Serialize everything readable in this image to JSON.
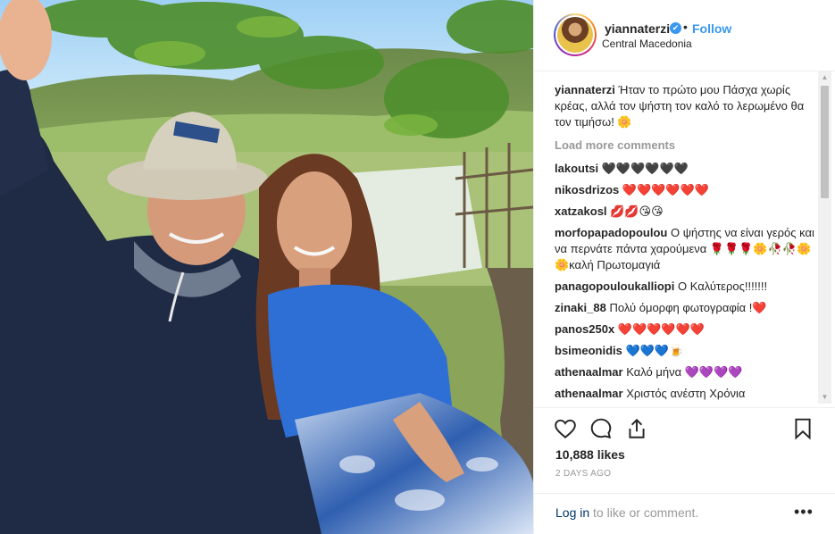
{
  "header": {
    "username": "yiannaterzi",
    "verified_mark": "✔",
    "separator": "•",
    "follow_label": "Follow",
    "location": "Central Macedonia"
  },
  "caption": {
    "username": "yiannaterzi",
    "text": "Ήταν το πρώτο μου Πάσχα χωρίς κρέας, αλλά τον ψήστη τον καλό το λερωμένο θα τον τιμήσω! 🌼"
  },
  "load_more_label": "Load more comments",
  "comments": [
    {
      "username": "lakoutsi",
      "text": "🖤🖤🖤🖤🖤🖤"
    },
    {
      "username": "nikosdrizos",
      "text": "❤️❤️❤️❤️❤️❤️"
    },
    {
      "username": "xatzakosl",
      "text": "💋💋😘😘"
    },
    {
      "username": "morfopapadopoulou",
      "text": "Ο ψήστης να είναι γερός και να περνάτε πάντα χαρούμενα 🌹🌹🌹🌼🥀🥀🌼🌼καλή Πρωτομαγιά"
    },
    {
      "username": "panagopouloukalliopi",
      "text": "Ο Καλύτερος!!!!!!!"
    },
    {
      "username": "zinaki_88",
      "text": "Πολύ όμορφη φωτογραφία !❤️"
    },
    {
      "username": "panos250x",
      "text": "❤️❤️❤️❤️❤️❤️"
    },
    {
      "username": "bsimeonidis",
      "text": "💙💙💙🍺"
    },
    {
      "username": "athenaalmar",
      "text": "Καλό μήνα 💜💜💜💜"
    },
    {
      "username": "athenaalmar",
      "text": "Χριστός ανέστη Χρόνια"
    }
  ],
  "icons": {
    "like": "heart-icon",
    "comment": "comment-icon",
    "share": "share-icon",
    "save": "bookmark-icon",
    "more": "more-options-icon"
  },
  "likes_text": "10,888 likes",
  "timestamp": "2 DAYS AGO",
  "footer": {
    "login_link": "Log in",
    "login_rest": " to like or comment.",
    "more_label": "•••"
  },
  "colors": {
    "accent": "#3897f0",
    "muted": "#999999",
    "text": "#262626",
    "border": "#efefef"
  }
}
